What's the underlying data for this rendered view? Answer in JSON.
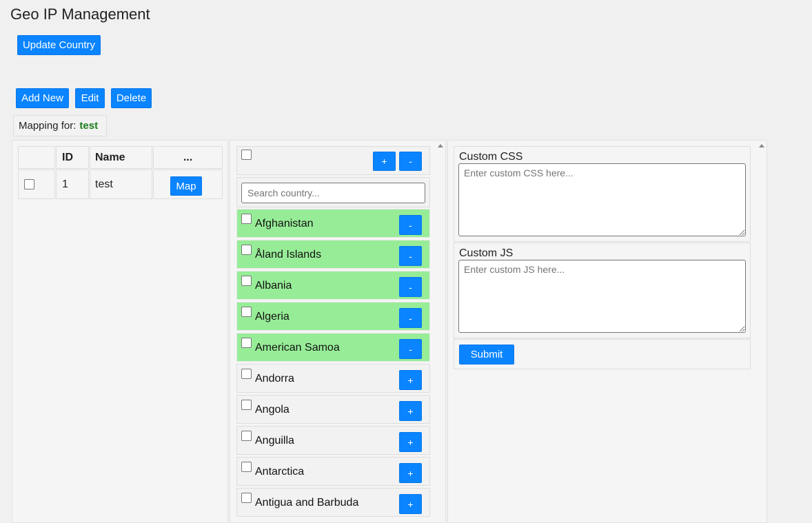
{
  "page": {
    "title": "Geo IP Management"
  },
  "toolbar": {
    "update_country": "Update Country",
    "add_new": "Add New",
    "edit": "Edit",
    "delete": "Delete"
  },
  "mapping": {
    "label": "Mapping for:",
    "value": "test"
  },
  "table": {
    "headers": [
      "",
      "ID",
      "Name",
      "..."
    ],
    "rows": [
      {
        "id": "1",
        "name": "test",
        "action": "Map"
      }
    ]
  },
  "countries": {
    "add_all": "+",
    "remove_all": "-",
    "search_placeholder": "Search country...",
    "items": [
      {
        "name": "Afghanistan",
        "selected": true,
        "action": "-"
      },
      {
        "name": "Åland Islands",
        "selected": true,
        "action": "-"
      },
      {
        "name": "Albania",
        "selected": true,
        "action": "-"
      },
      {
        "name": "Algeria",
        "selected": true,
        "action": "-"
      },
      {
        "name": "American Samoa",
        "selected": true,
        "action": "-"
      },
      {
        "name": "Andorra",
        "selected": false,
        "action": "+"
      },
      {
        "name": "Angola",
        "selected": false,
        "action": "+"
      },
      {
        "name": "Anguilla",
        "selected": false,
        "action": "+"
      },
      {
        "name": "Antarctica",
        "selected": false,
        "action": "+"
      },
      {
        "name": "Antigua and Barbuda",
        "selected": false,
        "action": "+"
      }
    ]
  },
  "custom": {
    "css_label": "Custom CSS",
    "css_placeholder": "Enter custom CSS here...",
    "js_label": "Custom JS",
    "js_placeholder": "Enter custom JS here...",
    "submit": "Submit"
  },
  "colors": {
    "accent": "#0a84ff",
    "selected_row": "#97ed97",
    "mapping_value": "#1b7d1b"
  }
}
